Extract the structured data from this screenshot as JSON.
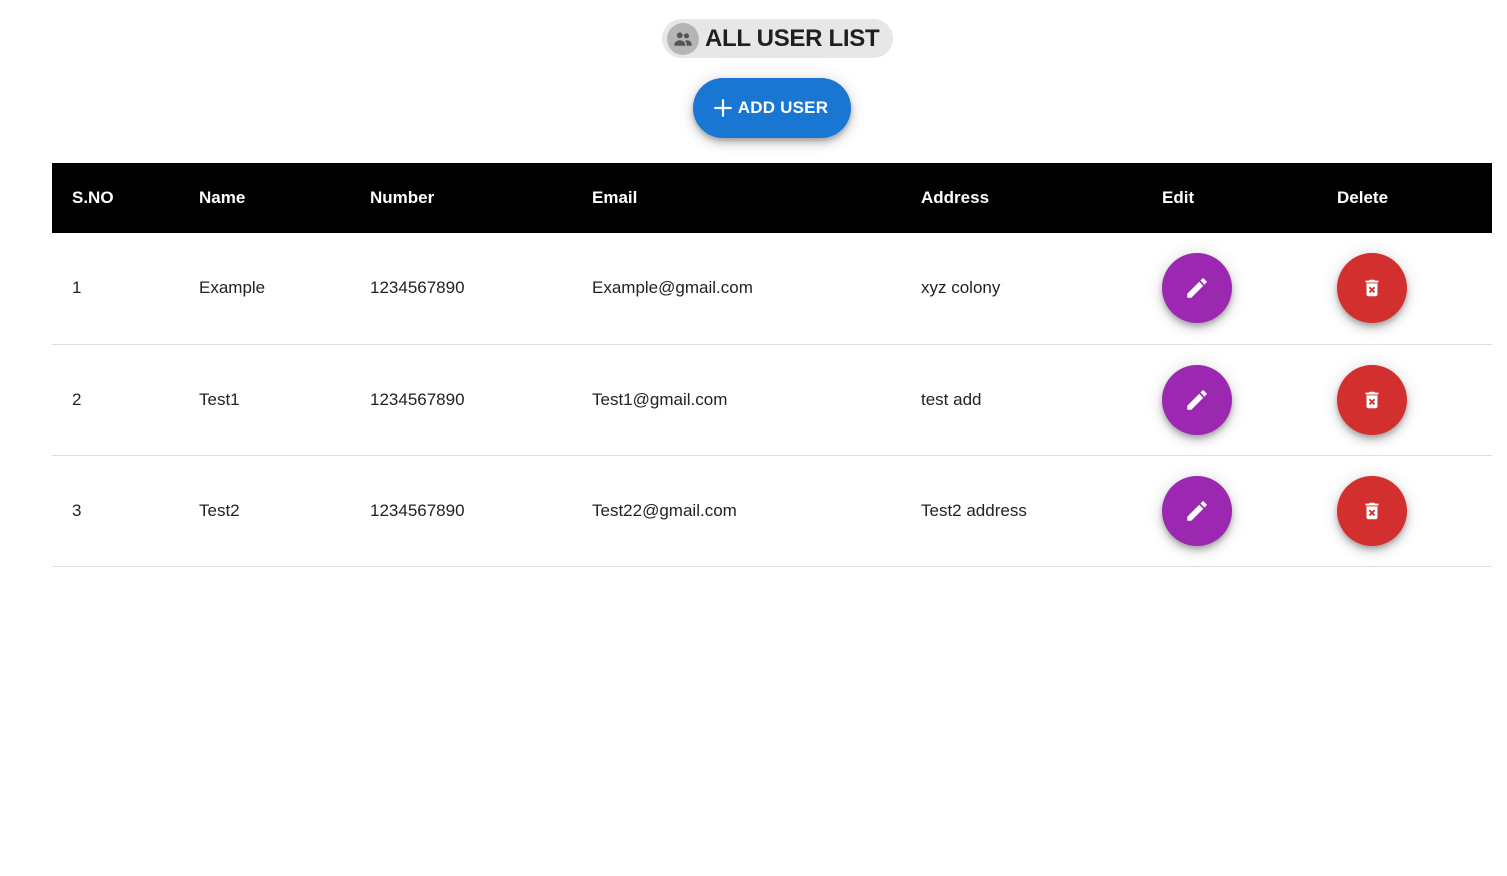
{
  "header": {
    "title": "ALL USER LIST",
    "title_icon": "group-icon",
    "add_button_label": "ADD USER",
    "add_button_icon": "plus-icon"
  },
  "colors": {
    "primary": "#1976d2",
    "edit": "#9c27b0",
    "delete": "#d32f2f",
    "table_header_bg": "#000000"
  },
  "table": {
    "columns": [
      "S.NO",
      "Name",
      "Number",
      "Email",
      "Address",
      "Edit",
      "Delete"
    ],
    "rows": [
      {
        "sno": "1",
        "name": "Example",
        "number": "1234567890",
        "email": "Example@gmail.com",
        "address": "xyz colony"
      },
      {
        "sno": "2",
        "name": "Test1",
        "number": "1234567890",
        "email": "Test1@gmail.com",
        "address": "test add"
      },
      {
        "sno": "3",
        "name": "Test2",
        "number": "1234567890",
        "email": "Test22@gmail.com",
        "address": "Test2 address"
      }
    ],
    "edit_icon": "pencil-icon",
    "delete_icon": "trash-icon"
  }
}
